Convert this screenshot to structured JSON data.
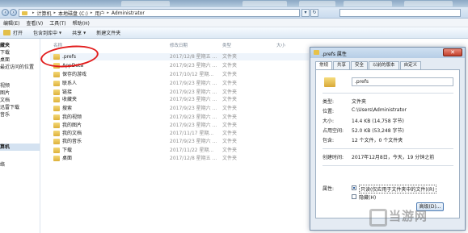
{
  "address_bar": {
    "crumbs": [
      "计算机",
      "本地磁盘 (C:)",
      "用户",
      "Administrator"
    ]
  },
  "menubar": {
    "items": [
      "编辑(E)",
      "查看(V)",
      "工具(T)",
      "帮助(H)"
    ]
  },
  "toolbar": {
    "open": "打开",
    "include_in_library": "包含到库中",
    "share": "共享",
    "new_folder": "新建文件夹"
  },
  "sidebar": {
    "items": [
      "藏夹",
      "下载",
      "桌面",
      "最近访问的位置",
      "",
      "视频",
      "图片",
      "文档",
      "迅雷下载",
      "音乐",
      "",
      "算机",
      "",
      "络"
    ]
  },
  "columns": {
    "name": "名称",
    "date": "修改日期",
    "type": "类型",
    "size": "大小"
  },
  "files": [
    {
      "name": ".prefs",
      "date": "2017/12/8 星期五 ...",
      "type": "文件夹"
    },
    {
      "name": "AppData",
      "date": "2017/9/23 星期六 ...",
      "type": "文件夹"
    },
    {
      "name": "保存的游戏",
      "date": "2017/10/12 星期...",
      "type": "文件夹"
    },
    {
      "name": "联系人",
      "date": "2017/9/23 星期六 ...",
      "type": "文件夹"
    },
    {
      "name": "链接",
      "date": "2017/9/23 星期六 ...",
      "type": "文件夹"
    },
    {
      "name": "收藏夹",
      "date": "2017/9/23 星期六 ...",
      "type": "文件夹"
    },
    {
      "name": "搜索",
      "date": "2017/9/23 星期六 ...",
      "type": "文件夹"
    },
    {
      "name": "我的视频",
      "date": "2017/9/23 星期六 ...",
      "type": "文件夹"
    },
    {
      "name": "我的图片",
      "date": "2017/9/23 星期六 ...",
      "type": "文件夹"
    },
    {
      "name": "我的文档",
      "date": "2017/11/17 星期...",
      "type": "文件夹"
    },
    {
      "name": "我的音乐",
      "date": "2017/9/23 星期六 ...",
      "type": "文件夹"
    },
    {
      "name": "下载",
      "date": "2017/11/22 星期...",
      "type": "文件夹"
    },
    {
      "name": "桌面",
      "date": "2017/12/8 星期五 ...",
      "type": "文件夹"
    }
  ],
  "dialog": {
    "title": ".prefs 属性",
    "close_glyph": "✕",
    "tabs": [
      "常规",
      "共享",
      "安全",
      "以前的版本",
      "自定义"
    ],
    "folder_name": ".prefs",
    "props": [
      {
        "label": "类型:",
        "value": "文件夹"
      },
      {
        "label": "位置:",
        "value": "C:\\Users\\Administrator"
      },
      {
        "label": "大小:",
        "value": "14.4 KB (14,758 字节)"
      },
      {
        "label": "占用空间:",
        "value": "52.0 KB (53,248 字节)"
      },
      {
        "label": "包含:",
        "value": "12 个文件，0 个文件夹"
      }
    ],
    "created_label": "创建时间:",
    "created_value": "2017年12月8日，今天，19 分钟之前",
    "attributes_label": "属性:",
    "readonly_label": "只读(仅应用于文件夹中的文件)(R)",
    "hidden_label": "隐藏(H)",
    "advanced_button": "高级(D)..."
  },
  "watermark": {
    "text": "当游网"
  }
}
